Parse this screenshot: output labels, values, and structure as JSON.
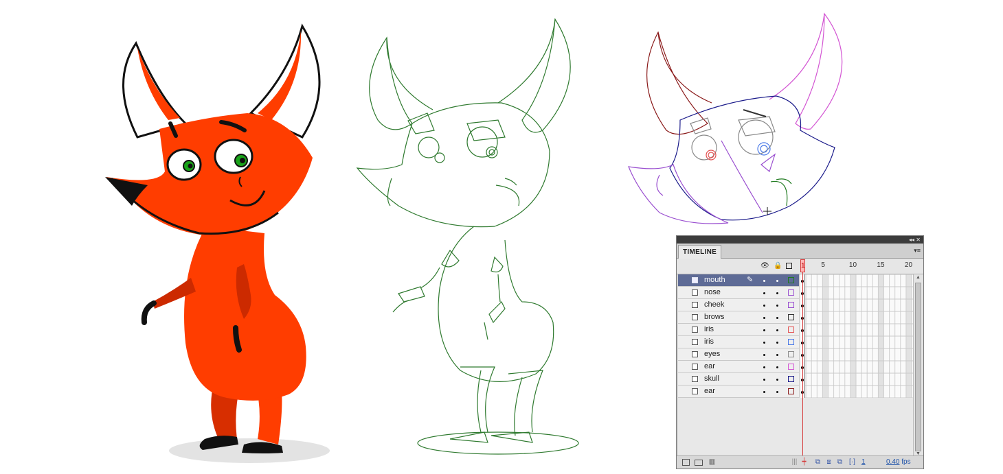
{
  "timeline": {
    "tab_label": "TIMELINE",
    "collapse_glyph": "◂◂",
    "close_glyph": "✕",
    "menu_glyph": "▾≡",
    "header_icons": [
      "eye-icon",
      "lock-icon",
      "outline-icon"
    ],
    "frame_numbers": [
      "1",
      "5",
      "10",
      "15",
      "20"
    ],
    "layers": [
      {
        "name": "mouth",
        "color": "#1f7a1f",
        "selected": true
      },
      {
        "name": "nose",
        "color": "#9a4fd0",
        "selected": false
      },
      {
        "name": "cheek",
        "color": "#9a4fd0",
        "selected": false
      },
      {
        "name": "brows",
        "color": "#333333",
        "selected": false
      },
      {
        "name": "iris",
        "color": "#e35050",
        "selected": false
      },
      {
        "name": "iris",
        "color": "#4a7ae8",
        "selected": false
      },
      {
        "name": "eyes",
        "color": "#8a8a8a",
        "selected": false
      },
      {
        "name": "ear",
        "color": "#d355d3",
        "selected": false
      },
      {
        "name": "skull",
        "color": "#1a1a8a",
        "selected": false
      },
      {
        "name": "ear",
        "color": "#8a1a1a",
        "selected": false
      }
    ],
    "pencil_glyph": "✎",
    "current_frame": "1",
    "frame_rate": "0.40",
    "fps_label": "fps",
    "playhead_label": "1"
  },
  "icons": {
    "new-layer": "▭",
    "new-folder": "▢",
    "delete": "🗑"
  },
  "colors": {
    "body_red": "#ff3d00",
    "dark_red": "#cc2a00",
    "green_sketch": "#2f7a2f",
    "selected_layer": "#5e6b96",
    "playhead": "#d53a3a"
  }
}
